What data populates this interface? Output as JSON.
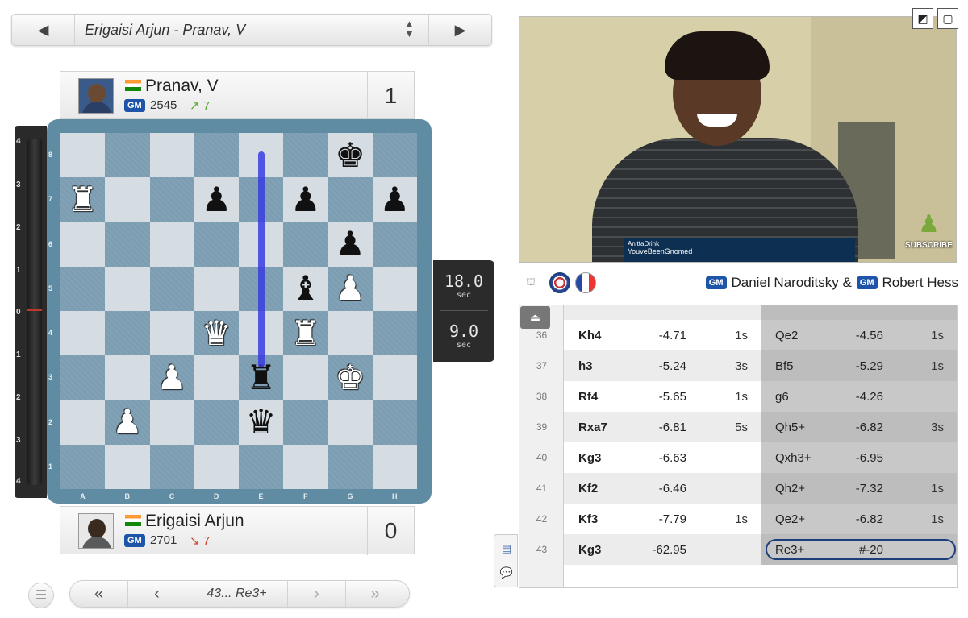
{
  "game_bar": {
    "title": "Erigaisi Arjun - Pranav, V"
  },
  "top_player": {
    "name": "Pranav, V",
    "title": "GM",
    "rating": "2545",
    "rating_change": "↗ 7",
    "score": "1",
    "delta_color": "#5aa632"
  },
  "bottom_player": {
    "name": "Erigaisi Arjun",
    "title": "GM",
    "rating": "2701",
    "rating_change": "↘ 7",
    "score": "0",
    "delta_color": "#d0452b"
  },
  "eval_bar": {
    "ticks_top": [
      "4",
      "3",
      "2",
      "1",
      "0",
      "1",
      "2",
      "3",
      "4"
    ]
  },
  "board": {
    "ranks": [
      "8",
      "7",
      "6",
      "5",
      "4",
      "3",
      "2",
      "1"
    ],
    "files": [
      "A",
      "B",
      "C",
      "D",
      "E",
      "F",
      "G",
      "H"
    ],
    "pieces": [
      {
        "sq": "g8",
        "glyph": "♚",
        "color": "b"
      },
      {
        "sq": "a7",
        "glyph": "♜",
        "color": "w"
      },
      {
        "sq": "d7",
        "glyph": "♟",
        "color": "b"
      },
      {
        "sq": "f7",
        "glyph": "♟",
        "color": "b"
      },
      {
        "sq": "h7",
        "glyph": "♟",
        "color": "b"
      },
      {
        "sq": "g6",
        "glyph": "♟",
        "color": "b"
      },
      {
        "sq": "f5",
        "glyph": "♝",
        "color": "b"
      },
      {
        "sq": "g5",
        "glyph": "♟",
        "color": "w"
      },
      {
        "sq": "d4",
        "glyph": "♛",
        "color": "w"
      },
      {
        "sq": "f4",
        "glyph": "♜",
        "color": "w"
      },
      {
        "sq": "c3",
        "glyph": "♟",
        "color": "w"
      },
      {
        "sq": "e3",
        "glyph": "♜",
        "color": "b"
      },
      {
        "sq": "g3",
        "glyph": "♚",
        "color": "w"
      },
      {
        "sq": "b2",
        "glyph": "♟",
        "color": "w"
      },
      {
        "sq": "e2",
        "glyph": "♛",
        "color": "b"
      }
    ]
  },
  "clocks": {
    "top_time": "18.0",
    "top_unit": "sec",
    "bottom_time": "9.0",
    "bottom_unit": "sec"
  },
  "move_nav": {
    "first_icon": "double-chevron-left-icon",
    "prev_icon": "chevron-left-icon",
    "current": "43... Re3+",
    "next_icon": "chevron-right-icon",
    "last_icon": "double-chevron-right-icon"
  },
  "video": {
    "lower_third_line1": "AnittaDrink",
    "lower_third_line2": "YouveBeenGnomed",
    "subscribe": "SUBSCRIBE"
  },
  "commentary": {
    "title1": "GM",
    "name1": "Daniel Naroditsky &",
    "title2": "GM",
    "name2": "Robert Hess"
  },
  "moves": [
    {
      "num": "36",
      "w": "Kh4",
      "we": "-4.71",
      "wt": "1s",
      "b": "Qe2",
      "be": "-4.56",
      "bt": "1s"
    },
    {
      "num": "37",
      "w": "h3",
      "we": "-5.24",
      "wt": "3s",
      "b": "Bf5",
      "be": "-5.29",
      "bt": "1s"
    },
    {
      "num": "38",
      "w": "Rf4",
      "we": "-5.65",
      "wt": "1s",
      "b": "g6",
      "be": "-4.26",
      "bt": ""
    },
    {
      "num": "39",
      "w": "Rxa7",
      "we": "-6.81",
      "wt": "5s",
      "b": "Qh5+",
      "be": "-6.82",
      "bt": "3s"
    },
    {
      "num": "40",
      "w": "Kg3",
      "we": "-6.63",
      "wt": "",
      "b": "Qxh3+",
      "be": "-6.95",
      "bt": ""
    },
    {
      "num": "41",
      "w": "Kf2",
      "we": "-6.46",
      "wt": "",
      "b": "Qh2+",
      "be": "-7.32",
      "bt": "1s"
    },
    {
      "num": "42",
      "w": "Kf3",
      "we": "-7.79",
      "wt": "1s",
      "b": "Qe2+",
      "be": "-6.82",
      "bt": "1s"
    },
    {
      "num": "43",
      "w": "Kg3",
      "we": "-62.95",
      "wt": "",
      "b": "Re3+",
      "be": "#-20",
      "bt": ""
    }
  ]
}
